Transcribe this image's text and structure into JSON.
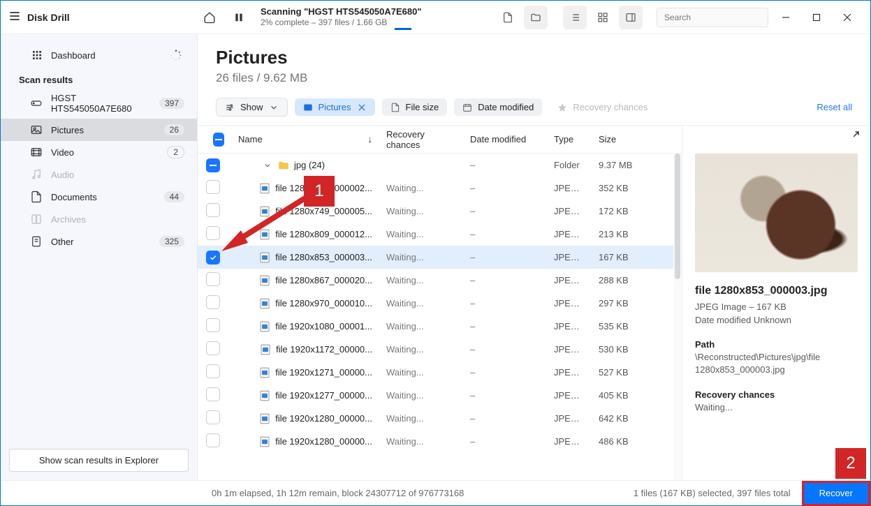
{
  "app": {
    "title": "Disk Drill"
  },
  "topbar": {
    "scan_title": "Scanning \"HGST HTS545050A7E680\"",
    "scan_sub": "2% complete – 397 files / 1.66 GB",
    "search_placeholder": "Search"
  },
  "sidebar": {
    "dashboard": "Dashboard",
    "scanresults": "Scan results",
    "items": [
      {
        "label": "HGST HTS545050A7E680",
        "count": "397"
      },
      {
        "label": "Pictures",
        "count": "26"
      },
      {
        "label": "Video",
        "count": "2"
      },
      {
        "label": "Audio",
        "count": ""
      },
      {
        "label": "Documents",
        "count": "44"
      },
      {
        "label": "Archives",
        "count": ""
      },
      {
        "label": "Other",
        "count": "325"
      }
    ],
    "explorer": "Show scan results in Explorer"
  },
  "header": {
    "title": "Pictures",
    "sub": "26 files / 9.62 MB"
  },
  "filters": {
    "show": "Show",
    "pictures": "Pictures",
    "filesize": "File size",
    "datemod": "Date modified",
    "recchances": "Recovery chances",
    "reset": "Reset all"
  },
  "columns": {
    "name": "Name",
    "rec": "Recovery chances",
    "date": "Date modified",
    "type": "Type",
    "size": "Size"
  },
  "folder": {
    "name": "jpg (24)",
    "rec": "",
    "date": "–",
    "type": "Folder",
    "size": "9.37 MB"
  },
  "files": [
    {
      "name": "file 1280x720_000002...",
      "rec": "Waiting...",
      "date": "–",
      "type": "JPEG Im...",
      "size": "352 KB",
      "selected": false
    },
    {
      "name": "file 1280x749_000005...",
      "rec": "Waiting...",
      "date": "–",
      "type": "JPEG Im...",
      "size": "172 KB",
      "selected": false
    },
    {
      "name": "file 1280x809_000012...",
      "rec": "Waiting...",
      "date": "–",
      "type": "JPEG Im...",
      "size": "213 KB",
      "selected": false
    },
    {
      "name": "file 1280x853_000003...",
      "rec": "Waiting...",
      "date": "–",
      "type": "JPEG Im...",
      "size": "167 KB",
      "selected": true
    },
    {
      "name": "file 1280x867_000020...",
      "rec": "Waiting...",
      "date": "–",
      "type": "JPEG Im...",
      "size": "288 KB",
      "selected": false
    },
    {
      "name": "file 1280x970_000010...",
      "rec": "Waiting...",
      "date": "–",
      "type": "JPEG Im...",
      "size": "297 KB",
      "selected": false
    },
    {
      "name": "file 1920x1080_00001...",
      "rec": "Waiting...",
      "date": "–",
      "type": "JPEG Im...",
      "size": "535 KB",
      "selected": false
    },
    {
      "name": "file 1920x1172_00000...",
      "rec": "Waiting...",
      "date": "–",
      "type": "JPEG Im...",
      "size": "530 KB",
      "selected": false
    },
    {
      "name": "file 1920x1271_00000...",
      "rec": "Waiting...",
      "date": "–",
      "type": "JPEG Im...",
      "size": "527 KB",
      "selected": false
    },
    {
      "name": "file 1920x1277_00000...",
      "rec": "Waiting...",
      "date": "–",
      "type": "JPEG Im...",
      "size": "405 KB",
      "selected": false
    },
    {
      "name": "file 1920x1280_00000...",
      "rec": "Waiting...",
      "date": "–",
      "type": "JPEG Im...",
      "size": "642 KB",
      "selected": false
    },
    {
      "name": "file 1920x1280_00000...",
      "rec": "Waiting...",
      "date": "–",
      "type": "JPEG Im...",
      "size": "486 KB",
      "selected": false
    }
  ],
  "preview": {
    "filename": "file 1280x853_000003.jpg",
    "typeinfo": "JPEG Image – 167 KB",
    "datemod": "Date modified Unknown",
    "path_h": "Path",
    "path_v": "\\Reconstructed\\Pictures\\jpg\\file 1280x853_000003.jpg",
    "rec_h": "Recovery chances",
    "rec_v": "Waiting..."
  },
  "status": {
    "left": "0h 1m elapsed, 1h 12m remain, block 24307712 of 976773168",
    "center": "1 files (167 KB) selected, 397 files total",
    "recover": "Recover"
  },
  "ann": {
    "one": "1",
    "two": "2"
  }
}
